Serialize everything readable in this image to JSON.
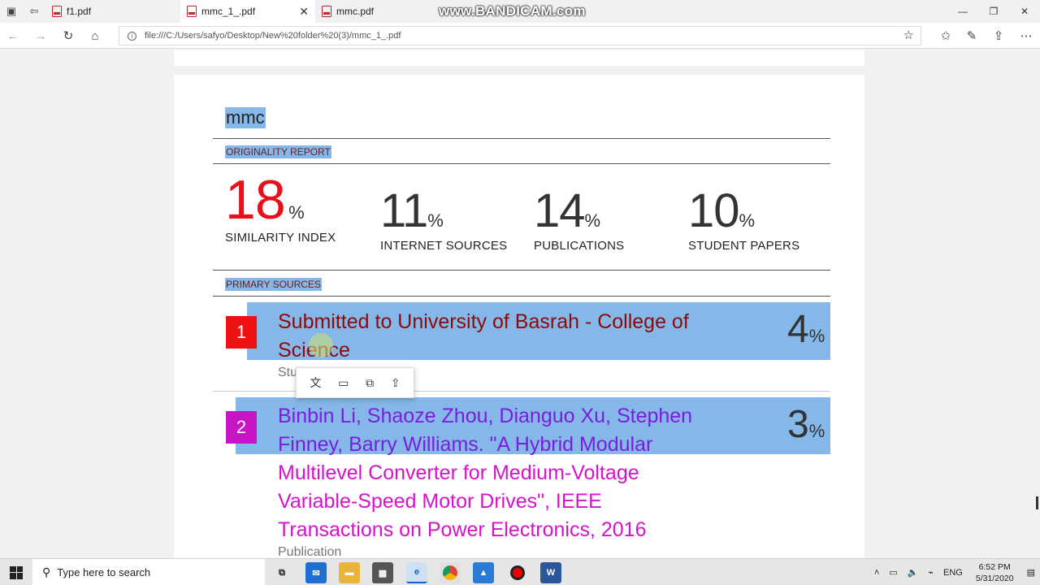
{
  "browser": {
    "tabs": [
      {
        "label": "f1.pdf",
        "active": false
      },
      {
        "label": "mmc_1_.pdf",
        "active": true
      },
      {
        "label": "mmc.pdf",
        "active": false
      }
    ],
    "watermark": "www.BANDICAM.com",
    "url": "file:///C:/Users/safyo/Desktop/New%20folder%20(3)/mmc_1_.pdf"
  },
  "report": {
    "title": "mmc",
    "originality_label": "ORIGINALITY REPORT",
    "stats": [
      {
        "value": "18",
        "pct": "%",
        "label": "SIMILARITY INDEX"
      },
      {
        "value": "11",
        "pct": "%",
        "label": "INTERNET SOURCES"
      },
      {
        "value": "14",
        "pct": "%",
        "label": "PUBLICATIONS"
      },
      {
        "value": "10",
        "pct": "%",
        "label": "STUDENT PAPERS"
      }
    ],
    "primary_label": "PRIMARY SOURCES",
    "sources": [
      {
        "num": "1",
        "lines": [
          "Submitted to University of Basrah - College of",
          "Science"
        ],
        "type": "Stu",
        "pct_value": "4",
        "pct_sign": "%",
        "color": "#8b0a0a",
        "badge_color": "#ee1111"
      },
      {
        "num": "2",
        "lines": [
          "Binbin Li, Shaoze Zhou, Dianguo Xu, Stephen",
          "Finney, Barry Williams. \"A Hybrid Modular",
          "Multilevel Converter for Medium-Voltage",
          "Variable-Speed Motor Drives\", IEEE",
          "Transactions on Power Electronics, 2016"
        ],
        "type": "Publication",
        "pct_value": "3",
        "pct_sign": "%",
        "color": "#d414c8",
        "badge_color": "#d414c8"
      }
    ]
  },
  "taskbar": {
    "search_placeholder": "Type here to search",
    "lang": "ENG",
    "time": "6:52 PM",
    "date": "5/31/2020"
  }
}
